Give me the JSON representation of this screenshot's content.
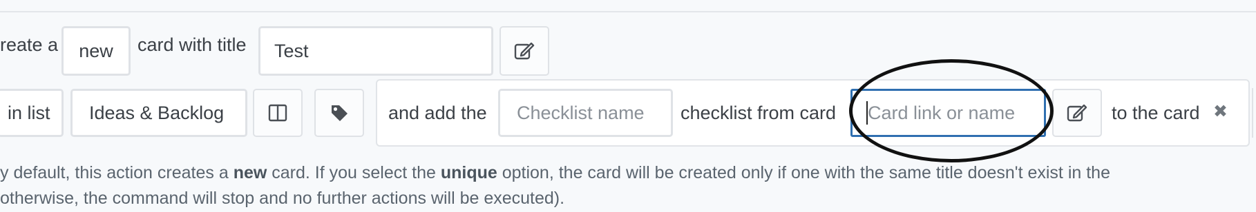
{
  "row1": {
    "prefix": "reate a",
    "mode_value": "new",
    "mid_text": "card with title",
    "title_value": "Test"
  },
  "row2": {
    "list_label": "in list",
    "list_value": "Ideas & Backlog",
    "and_add_text": "and add the",
    "checklist_placeholder": "Checklist name",
    "from_card_text": "checklist from card",
    "card_placeholder": "Card link or name",
    "to_card_text": "to the card",
    "remove_glyph": "✖"
  },
  "help": {
    "line1_a": "y default, this action creates a ",
    "line1_b": "new",
    "line1_c": " card. If you select the ",
    "line1_d": "unique",
    "line1_e": " option, the card will be created only if one with the same title doesn't exist in the",
    "line2": "otherwise, the command will stop and no further actions will be executed)."
  },
  "icons": {
    "edit": "edit-icon",
    "board": "board-columns-icon",
    "tag": "tag-icon",
    "close": "close-icon"
  },
  "colors": {
    "focus_border": "#2f6fb0",
    "border": "#dfe2e6",
    "background": "#f7f9fb"
  }
}
